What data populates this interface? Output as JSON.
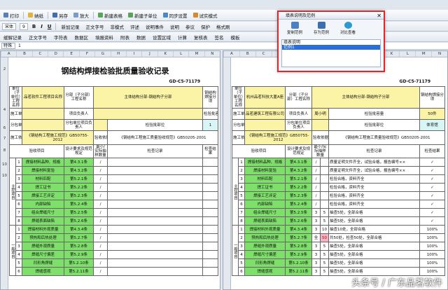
{
  "toolbar1": {
    "print": "打印",
    "open": "纳纸",
    "save": "另存",
    "zoom": "放大",
    "new_table": "新建表格",
    "new_sub": "新建子单位",
    "sync": "同步设置",
    "mode": "试实模式",
    "mode2": "试后模组"
  },
  "toolbar2": {
    "font": "宋体",
    "size": "9",
    "items": [
      "新加记录",
      "正文字号",
      "非模式",
      "评述",
      "说明事件",
      "说明",
      "参议",
      "保护",
      "格式刷"
    ]
  },
  "toolbar3": {
    "items": [
      "缓解记录",
      "正文字号",
      "字符表",
      "数据区",
      "填报资料",
      "附表",
      "数据",
      "设置区域",
      "计算",
      "复核表",
      "签名",
      "模板",
      "示例",
      "验收",
      "编辑",
      "空间"
    ]
  },
  "formula": {
    "ref": "特殊",
    "value": "1"
  },
  "columns": [
    "A",
    "B",
    "C",
    "D",
    "E",
    "F",
    "G",
    "H",
    "I",
    "J",
    "K",
    "L",
    "M",
    "N"
  ],
  "doc": {
    "title": "钢结构焊接检验批质量验收记录",
    "number": "GD-C5-71179",
    "number_right": "GD-C5-71179"
  },
  "left": {
    "unit_label": "单位（子单位）工程名称",
    "unit_value": "品茗软件工程项目名称",
    "sub_label": "分部（子分部）工程名称",
    "sub_value": "主体结构分部-钢结构子分部",
    "item_label": "分项工程名称",
    "item_value": "钢结构焊接分项",
    "contractor": "施工单位",
    "pm": "项目负责人",
    "batch_cap": "检验批容量",
    "subcontractor": "分包单位",
    "sub_pm": "分包单位项目负责人",
    "batch_part": "检验批部位",
    "batch_value": "1",
    "basis": "施工依据",
    "basis_value": "《钢结构工程施工规范》GB50755-2012",
    "accept": "验收依据",
    "accept_value": "《钢结构工程施工质量验收规范》GB50205-2001",
    "hdr": [
      "验收项目",
      "设计要求及规范规定",
      "最小/实际抽样数量",
      "检查记录",
      "检查结果"
    ],
    "main_label": "主控项目",
    "gen_label": "一般项目",
    "rows": [
      {
        "n": "1",
        "name": "焊接材料品种、规格",
        "ref": "第4.3.1条",
        "s": "/"
      },
      {
        "n": "2",
        "name": "焊接材料复验",
        "ref": "第4.3.2条",
        "s": "/"
      },
      {
        "n": "3",
        "name": "材料匹配",
        "ref": "第5.2.1条",
        "s": "/"
      },
      {
        "n": "4",
        "name": "焊工证书",
        "ref": "第5.2.2条",
        "s": "/"
      },
      {
        "n": "5",
        "name": "焊接工艺评定",
        "ref": "第5.2.3条",
        "s": "/"
      },
      {
        "n": "6",
        "name": "内部缺陷",
        "ref": "第5.2.4条",
        "s": "/"
      },
      {
        "n": "7",
        "name": "组合焊缝尺寸",
        "ref": "第5.2.5条",
        "s": "/"
      },
      {
        "n": "8",
        "name": "焊缝表面缺陷",
        "ref": "第5.2.6条",
        "s": "/"
      },
      {
        "n": "1",
        "name": "焊接材料外观质量",
        "ref": "第4.3.4条",
        "s": "/"
      },
      {
        "n": "2",
        "name": "预热和后热处理",
        "ref": "第5.2.7条",
        "s": "/"
      },
      {
        "n": "3",
        "name": "焊缝外观质量",
        "ref": "第5.2.8条",
        "s": "/"
      },
      {
        "n": "4",
        "name": "焊缝尺寸偏差",
        "ref": "第5.2.9条",
        "s": "/"
      },
      {
        "n": "5",
        "name": "凹形角焊缝",
        "ref": "第5.2.10条",
        "s": "/"
      },
      {
        "n": "6",
        "name": "焊缝感观",
        "ref": "第5.2.11条",
        "s": "/"
      }
    ],
    "footer": "专业工长："
  },
  "right": {
    "unit_value": "杭州品茗科技大厦A座",
    "sub_value": "主体结构分部-钢结构子分部",
    "item_value": "钢结构焊接分项",
    "contractor_value": "品茗建筑工程有限公司",
    "pm_value": "周小明",
    "batch_cap_value": "50件",
    "batch_part_value": "体育馆",
    "rows": [
      {
        "name": "焊接材料品种、规格",
        "ref": "第4.3.1条",
        "a": "/",
        "b": "",
        "rec": "质量证明文件齐全，试验合格，报告编号××",
        "res": "✓"
      },
      {
        "name": "焊接材料复验",
        "ref": "第4.3.2条",
        "a": "/",
        "b": "",
        "rec": "质量证明文件齐全，试验合格，报告编号××",
        "res": "✓"
      },
      {
        "name": "材料匹配",
        "ref": "第5.2.1条",
        "a": "/",
        "b": "",
        "rec": "检验合格，资料齐全",
        "res": "✓"
      },
      {
        "name": "焊工证书",
        "ref": "第5.2.2条",
        "a": "/",
        "b": "",
        "rec": "检验合格，资料齐全",
        "res": "✓"
      },
      {
        "name": "焊接工艺评定",
        "ref": "第5.2.3条",
        "a": "/",
        "b": "",
        "rec": "检验合格，资料齐全",
        "res": "✓"
      },
      {
        "name": "内部缺陷",
        "ref": "第5.2.4条",
        "a": "/",
        "b": "",
        "rec": "检验合格，资料齐全",
        "res": "✓"
      },
      {
        "name": "组合焊缝尺寸",
        "ref": "第5.2.5条",
        "a": "3",
        "b": "5",
        "rec": "抽查5处，全部合格",
        "res": "✓"
      },
      {
        "name": "焊缝表面缺陷",
        "ref": "第5.2.6条",
        "a": "3",
        "b": "5",
        "rec": "抽查5处，全部合格",
        "res": "✓"
      },
      {
        "name": "焊接材料外观质量",
        "ref": "第4.3.4条",
        "a": "3",
        "b": "10",
        "rec": "抽查10处，全部合格",
        "res": "100%"
      },
      {
        "name": "预热和后热处理",
        "ref": "第5.2.7条",
        "a": "全",
        "b": "50",
        "rec": "共50处，检查50处，全部合格",
        "res": "100%"
      },
      {
        "name": "焊缝外观质量",
        "ref": "第5.2.8条",
        "a": "3",
        "b": "5",
        "rec": "抽查5处，全部合格",
        "res": "100%"
      },
      {
        "name": "焊缝尺寸偏差",
        "ref": "第5.2.9条",
        "a": "3",
        "b": "5",
        "rec": "抽查5处，全部合格",
        "res": "100%"
      },
      {
        "name": "凹形角焊缝",
        "ref": "第5.2.10条",
        "a": "3",
        "b": "5",
        "rec": "抽查5处，全部合格",
        "res": "100%"
      },
      {
        "name": "焊缝感观",
        "ref": "第5.2.11条",
        "a": "3",
        "b": "5",
        "rec": "抽查5处，全部合格",
        "res": "100%"
      }
    ]
  },
  "dialog": {
    "title": "填表说明及范例",
    "copy": "复制范例",
    "save_as": "存为范例",
    "compare": "对比查看",
    "items": [
      "填表说明",
      "范例1"
    ]
  },
  "rownums": [
    "1",
    "2",
    "3",
    "4",
    "5",
    "6",
    "7",
    "8",
    "9",
    "10",
    "11",
    "12",
    "13",
    "14",
    "15",
    "16",
    "17",
    "18",
    "19",
    "20",
    "21",
    "22",
    "23",
    "24"
  ],
  "watermark": "头条号 / 广东品茗软件"
}
